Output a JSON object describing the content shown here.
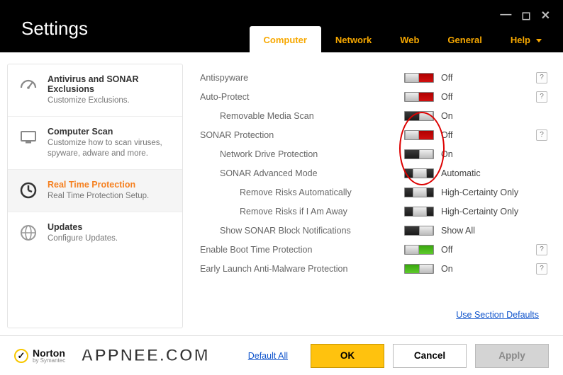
{
  "window": {
    "title": "Settings"
  },
  "tabs": {
    "computer": "Computer",
    "network": "Network",
    "web": "Web",
    "general": "General",
    "help": "Help"
  },
  "sidebar": {
    "items": [
      {
        "label": "Antivirus and SONAR Exclusions",
        "desc": "Customize Exclusions."
      },
      {
        "label": "Computer Scan",
        "desc": "Customize how to scan viruses, spyware, adware and more."
      },
      {
        "label": "Real Time Protection",
        "desc": "Real Time Protection Setup."
      },
      {
        "label": "Updates",
        "desc": "Configure Updates."
      }
    ]
  },
  "settings": {
    "rows": [
      {
        "label": "Antispyware",
        "value": "Off",
        "toggle": "off-red",
        "help": true,
        "indent": 0
      },
      {
        "label": "Auto-Protect",
        "value": "Off",
        "toggle": "off-red",
        "help": true,
        "indent": 0
      },
      {
        "label": "Removable Media Scan",
        "value": "On",
        "toggle": "on-grey",
        "help": false,
        "indent": 1
      },
      {
        "label": "SONAR Protection",
        "value": "Off",
        "toggle": "off-red",
        "help": true,
        "indent": 0
      },
      {
        "label": "Network Drive Protection",
        "value": "On",
        "toggle": "on-grey",
        "help": false,
        "indent": 1
      },
      {
        "label": "SONAR Advanced Mode",
        "value": "Automatic",
        "toggle": "mid-grey",
        "help": false,
        "indent": 1
      },
      {
        "label": "Remove Risks Automatically",
        "value": "High-Certainty Only",
        "toggle": "mid-grey",
        "help": false,
        "indent": 2
      },
      {
        "label": "Remove Risks if I Am Away",
        "value": "High-Certainty Only",
        "toggle": "mid-grey",
        "help": false,
        "indent": 2
      },
      {
        "label": "Show SONAR Block Notifications",
        "value": "Show All",
        "toggle": "on-grey",
        "help": false,
        "indent": 1
      },
      {
        "label": "Enable Boot Time Protection",
        "value": "Off",
        "toggle": "off-green",
        "help": true,
        "indent": 0
      },
      {
        "label": "Early Launch Anti-Malware Protection",
        "value": "On",
        "toggle": "on-green",
        "help": true,
        "indent": 0
      }
    ],
    "section_defaults": "Use Section Defaults"
  },
  "footer": {
    "brand": "Norton",
    "brand_sub": "by Symantec",
    "default_all": "Default All",
    "ok": "OK",
    "cancel": "Cancel",
    "apply": "Apply"
  },
  "watermark": "APPNEE.COM",
  "help_symbol": "?"
}
